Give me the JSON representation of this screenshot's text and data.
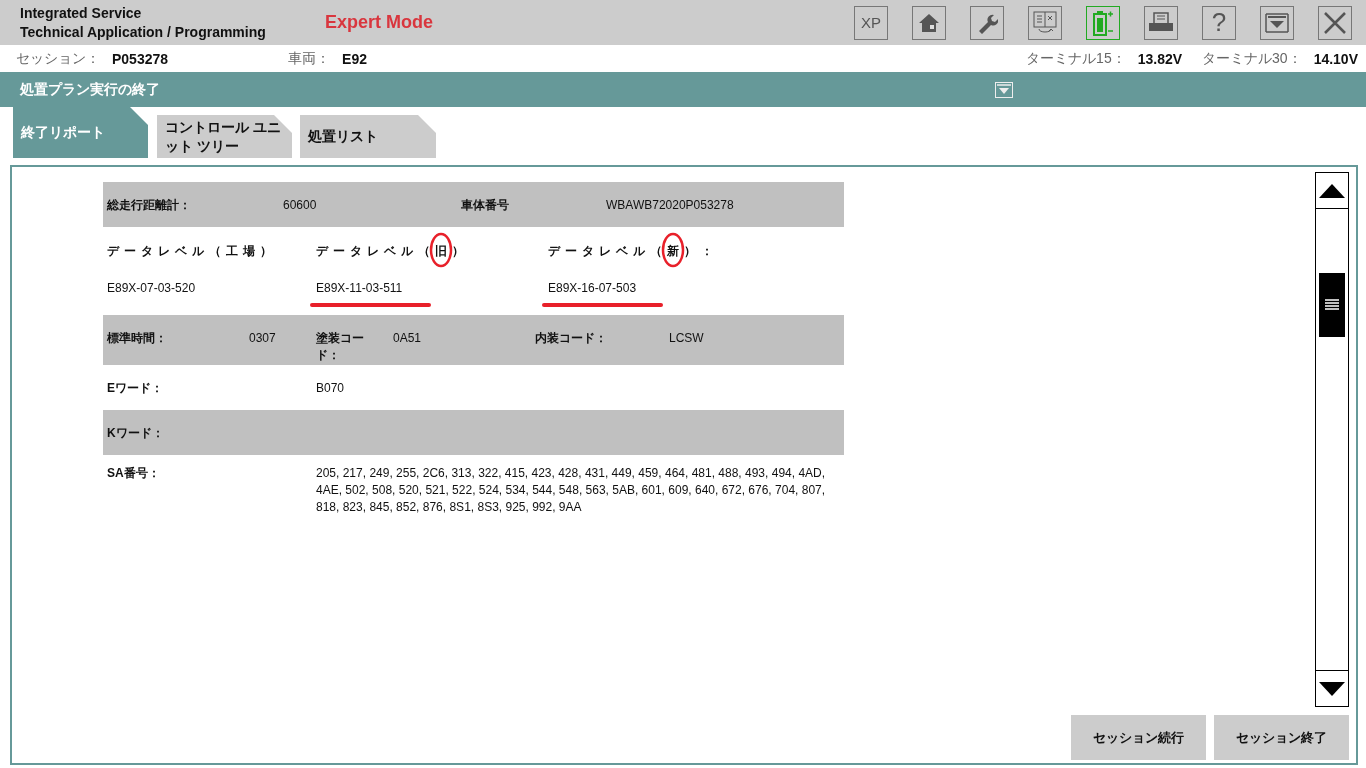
{
  "header": {
    "title_lines": [
      "Integrated Service",
      "Technical Application / Programming"
    ],
    "mode": "Expert Mode"
  },
  "toolbar": [
    {
      "kind": "text",
      "text": "XP"
    },
    {
      "kind": "home"
    },
    {
      "kind": "wrench"
    },
    {
      "kind": "swap"
    },
    {
      "kind": "battery"
    },
    {
      "kind": "printer"
    },
    {
      "kind": "text",
      "text": "?"
    },
    {
      "kind": "dropdown"
    },
    {
      "kind": "close"
    }
  ],
  "info_bar": {
    "left": [
      {
        "label": "セッション：",
        "value": "P053278"
      },
      {
        "label": "車両：",
        "value": "E92"
      }
    ],
    "right": [
      {
        "label": "ターミナル15：",
        "value": "13.82V"
      },
      {
        "label": "ターミナル30：",
        "value": "14.10V"
      }
    ]
  },
  "section_title": "処置プラン実行の終了",
  "tabs": [
    {
      "label": "終了リポート",
      "selected": true
    },
    {
      "label": "コントロール ユニット ツリー",
      "selected": false
    },
    {
      "label": "処置リスト",
      "selected": false
    }
  ],
  "report": [
    {
      "kind": "pairs",
      "shaded": true,
      "cells": [
        "総走行距離計：",
        "60600",
        "車体番号",
        "WBAWB72020P053278"
      ]
    },
    {
      "kind": "levels",
      "shaded": false,
      "levels": [
        {
          "header": "データレベル（工場）",
          "value": "E89X-07-03-520",
          "annotated": false
        },
        {
          "header": "データレベル（旧）",
          "value": "E89X-11-03-511",
          "annotated": true
        },
        {
          "header": "データレベル（新）：",
          "value": "E89X-16-07-503",
          "annotated": true
        }
      ]
    },
    {
      "kind": "triple",
      "shaded": true,
      "cells": [
        "標準時間：",
        "0307",
        "塗装コード：",
        "0A51",
        "内装コード：",
        "LCSW"
      ]
    },
    {
      "kind": "single",
      "shaded": false,
      "cells": [
        "Eワード：",
        "B070"
      ]
    },
    {
      "kind": "single",
      "shaded": true,
      "cells": [
        "Kワード："
      ]
    },
    {
      "kind": "single",
      "shaded": false,
      "cells": [
        "SA番号：",
        "205, 217, 249, 255, 2C6, 313, 322, 415, 423, 428, 431, 449, 459, 464, 481, 488, 493, 494, 4AD, 4AE, 502, 508, 520, 521, 522, 524, 534, 544, 548, 563, 5AB, 601, 609, 640, 672, 676, 704, 807, 818, 823, 845, 852, 876, 8S1, 8S3, 925, 992, 9AA"
      ]
    }
  ],
  "buttons": [
    "セッション続行",
    "セッション終了"
  ]
}
